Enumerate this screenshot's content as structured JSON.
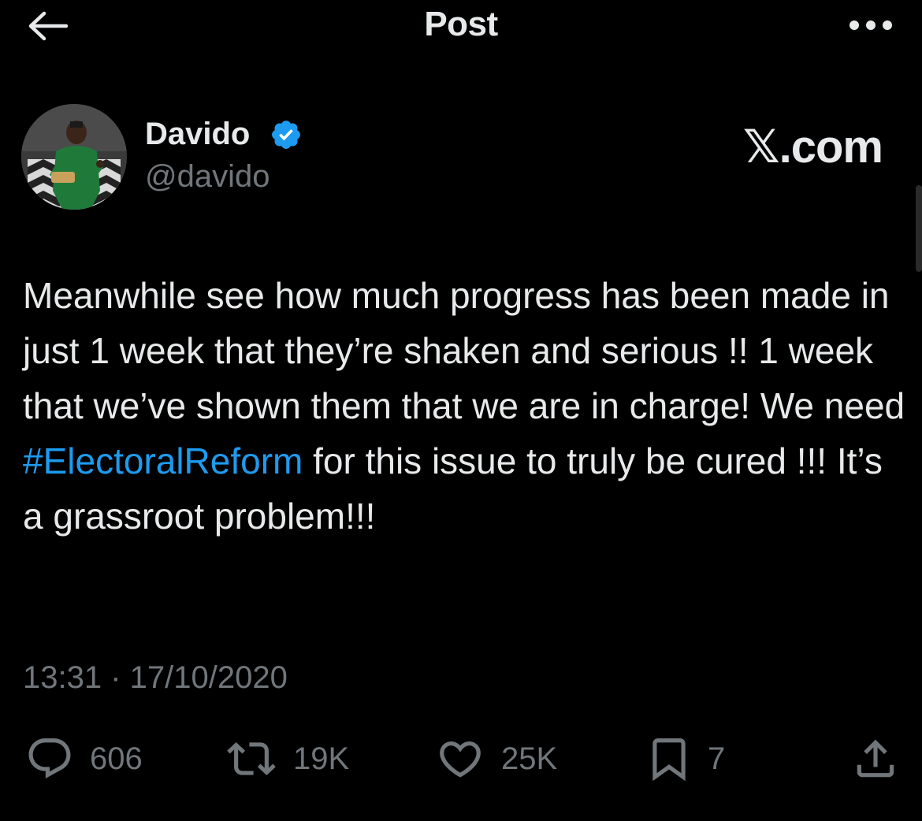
{
  "header": {
    "title": "Post",
    "back_icon": "arrow-left-icon",
    "more_icon": "more-horizontal-icon"
  },
  "author": {
    "display_name": "Davido",
    "handle": "@davido",
    "verified": true,
    "verified_color": "#1d9bf0"
  },
  "watermark": "𝕏.com",
  "tweet": {
    "text_before": "Meanwhile see how much progress has been made in just 1 week that they’re shaken and serious !! 1 week that we’ve shown them that we are in charge! We need ",
    "hashtag": "#ElectoralReform",
    "text_after": " for this issue to truly be cured !!! It’s a grassroot problem!!!",
    "timestamp": "13:31 · 17/10/2020"
  },
  "actions": {
    "replies": "606",
    "reposts": "19K",
    "likes": "25K",
    "bookmarks": "7"
  },
  "colors": {
    "background": "#000000",
    "text": "#e7e9ea",
    "secondary": "#71767b",
    "accent": "#1d9bf0"
  }
}
